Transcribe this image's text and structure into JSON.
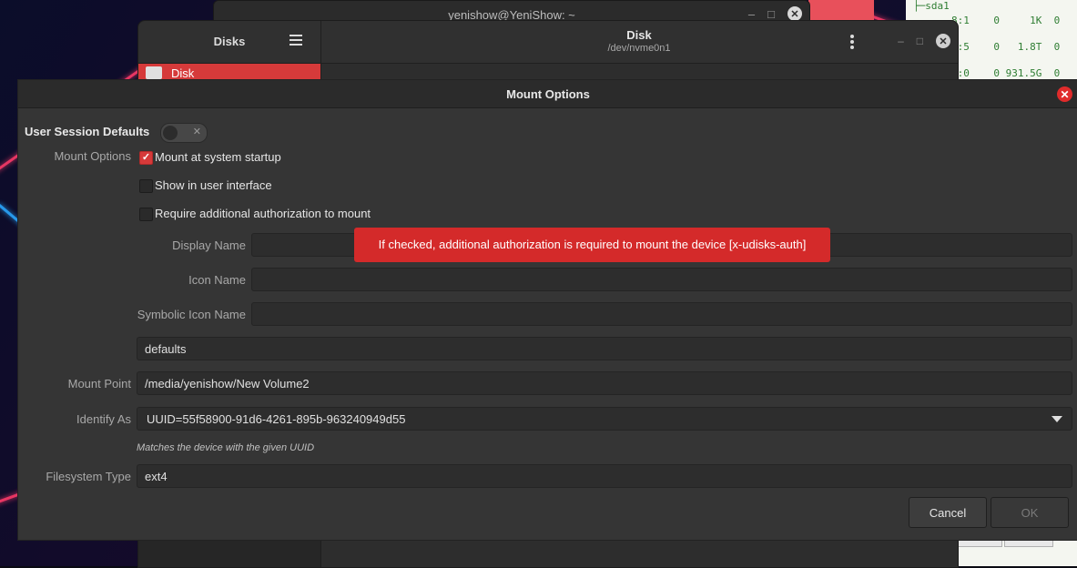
{
  "terminal": {
    "title": "yenishow@YeniShow: ~"
  },
  "lsblk": {
    "lines": [
      "├─sda1",
      "8:1    0     1K  0",
      "8:5    0   1.8T  0",
      "9:0    0 931.5G  0"
    ]
  },
  "disks_app": {
    "sidebar_title": "Disks",
    "title": "Disk",
    "subtitle": "/dev/nvme0n1",
    "selected_item": "Disk"
  },
  "dialog": {
    "title": "Mount Options",
    "user_session_defaults": "User Session Defaults",
    "mount_options_label": "Mount Options",
    "checkboxes": [
      {
        "label": "Mount at system startup",
        "checked": true
      },
      {
        "label": "Show in user interface",
        "checked": false
      },
      {
        "label": "Require additional authorization to mount",
        "checked": false
      }
    ],
    "display_name_label": "Display Name",
    "display_name_value": "",
    "icon_name_label": "Icon Name",
    "icon_name_value": "",
    "symbolic_icon_name_label": "Symbolic Icon Name",
    "symbolic_icon_name_value": "",
    "options_value": "defaults",
    "mount_point_label": "Mount Point",
    "mount_point_value": "/media/yenishow/New Volume2",
    "identify_as_label": "Identify As",
    "identify_as_value": "UUID=55f58900-91d6-4261-895b-963240949d55",
    "identify_hint": "Matches the device with the given UUID",
    "fs_type_label": "Filesystem Type",
    "fs_type_value": "ext4",
    "tooltip": "If checked, additional authorization is required to mount the device [x-udisks-auth]",
    "cancel": "Cancel",
    "ok": "OK"
  },
  "colors": {
    "accent": "#d63a3a",
    "dialog_bg": "#353535",
    "field_bg": "#2d2d2d"
  }
}
